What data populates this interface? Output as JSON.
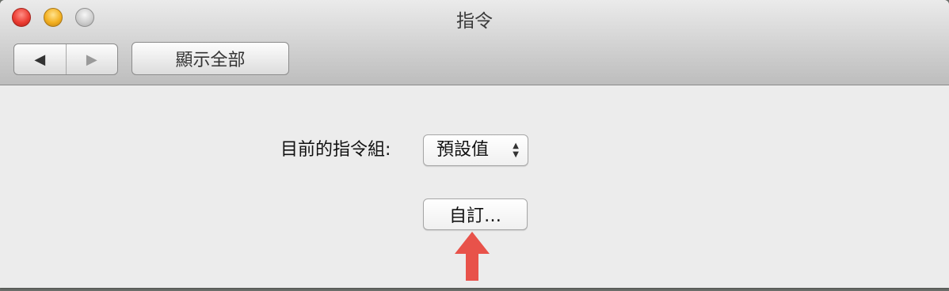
{
  "window": {
    "title": "指令"
  },
  "toolbar": {
    "back_icon": "◀",
    "forward_icon": "▶",
    "show_all_label": "顯示全部"
  },
  "main": {
    "command_set_label": "目前的指令組:",
    "command_set_value": "預設值",
    "customize_label": "自訂…"
  },
  "colors": {
    "annotation_arrow": "#e8524a"
  },
  "icons": {
    "popup_arrows": "updown-chevron-icon",
    "annotation": "red-up-arrow-icon"
  }
}
